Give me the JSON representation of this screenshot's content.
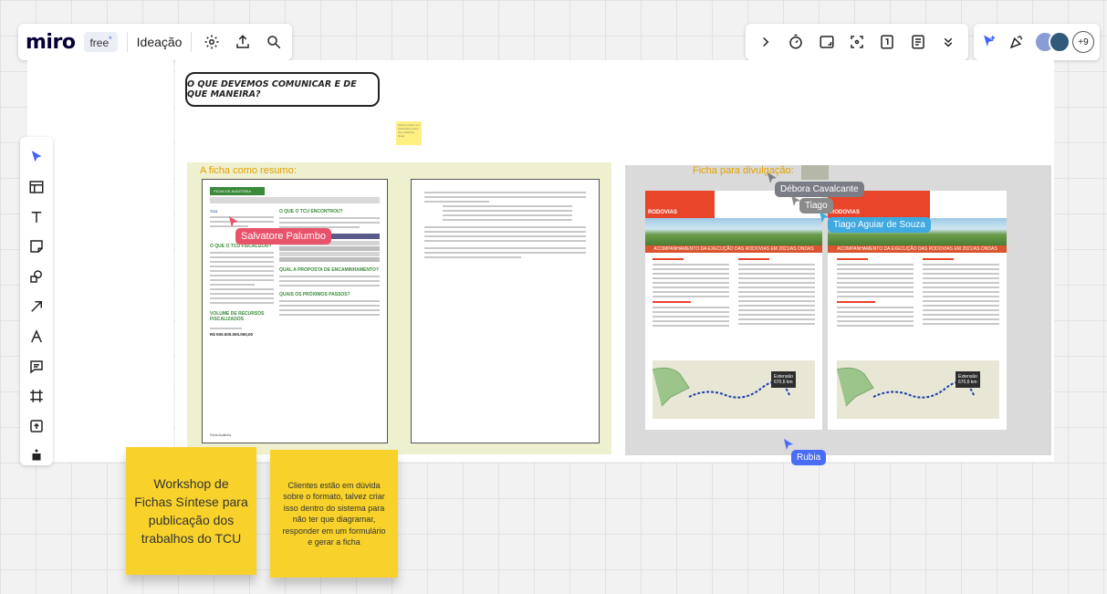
{
  "topbar": {
    "logo": "miro",
    "plan": "free",
    "plan_mark": "*",
    "board_name": "Ideação"
  },
  "frame": {
    "heading": "O QUE DEVEMOS COMUNICAR E DE QUE MANEIRA?",
    "mini_note": "Fichas podem ser publicadas antes dos relatórios finais",
    "left_section_label": "A ficha como resumo:",
    "right_section_label": "Ficha para divulgação:"
  },
  "doc1": {
    "banner": "FICHA DE AUDITORIA",
    "q1": "O QUE O TCU ENCONTROU?",
    "q2": "O QUE O TCU FISCALIZOU?",
    "q3": "QUAL A PROPOSTA DE ENCAMINHAMENTO?",
    "q4": "QUAIS OS PRÓXIMOS PASSOS?",
    "vol_title": "VOLUME DE RECURSOS FISCALIZADOS",
    "vol_value": "R$ 000.000.000.000,00",
    "footer": "Ficha Auditoria"
  },
  "brochure": {
    "section": "RODOVIAS",
    "strip_text": "ACOMPANHAMENTO DA EXECUÇÃO DAS RODOVIAS EM 2021/AS ONDAS",
    "map_label": "Extensão",
    "map_value": "670,6 km"
  },
  "cursors": [
    {
      "name": "Salvatore Palumbo",
      "color": "#e8536b"
    },
    {
      "name": "Débora Cavalcante",
      "color": "#7a7d85"
    },
    {
      "name": "Tiago",
      "color": "#8a8a8a"
    },
    {
      "name": "Tiago Aguiar de Souza",
      "color": "#3fa9e0"
    },
    {
      "name": "Rubia",
      "color": "#4a6cf7"
    }
  ],
  "collaborators": {
    "extra_count": "+9"
  },
  "stickies": {
    "workshop": "Workshop de Fichas Síntese para publicação dos trabalhos do TCU",
    "clients": "Clientes estão em dúvida sobre o formato, talvez criar isso dentro do sistema para não ter que diagramar, responder em um formulário e gerar a ficha"
  },
  "colors": {
    "sticky": "#f8d22a",
    "accent": "#4262ff",
    "frame_green": "#eef0cf",
    "frame_grey": "#dadada"
  }
}
